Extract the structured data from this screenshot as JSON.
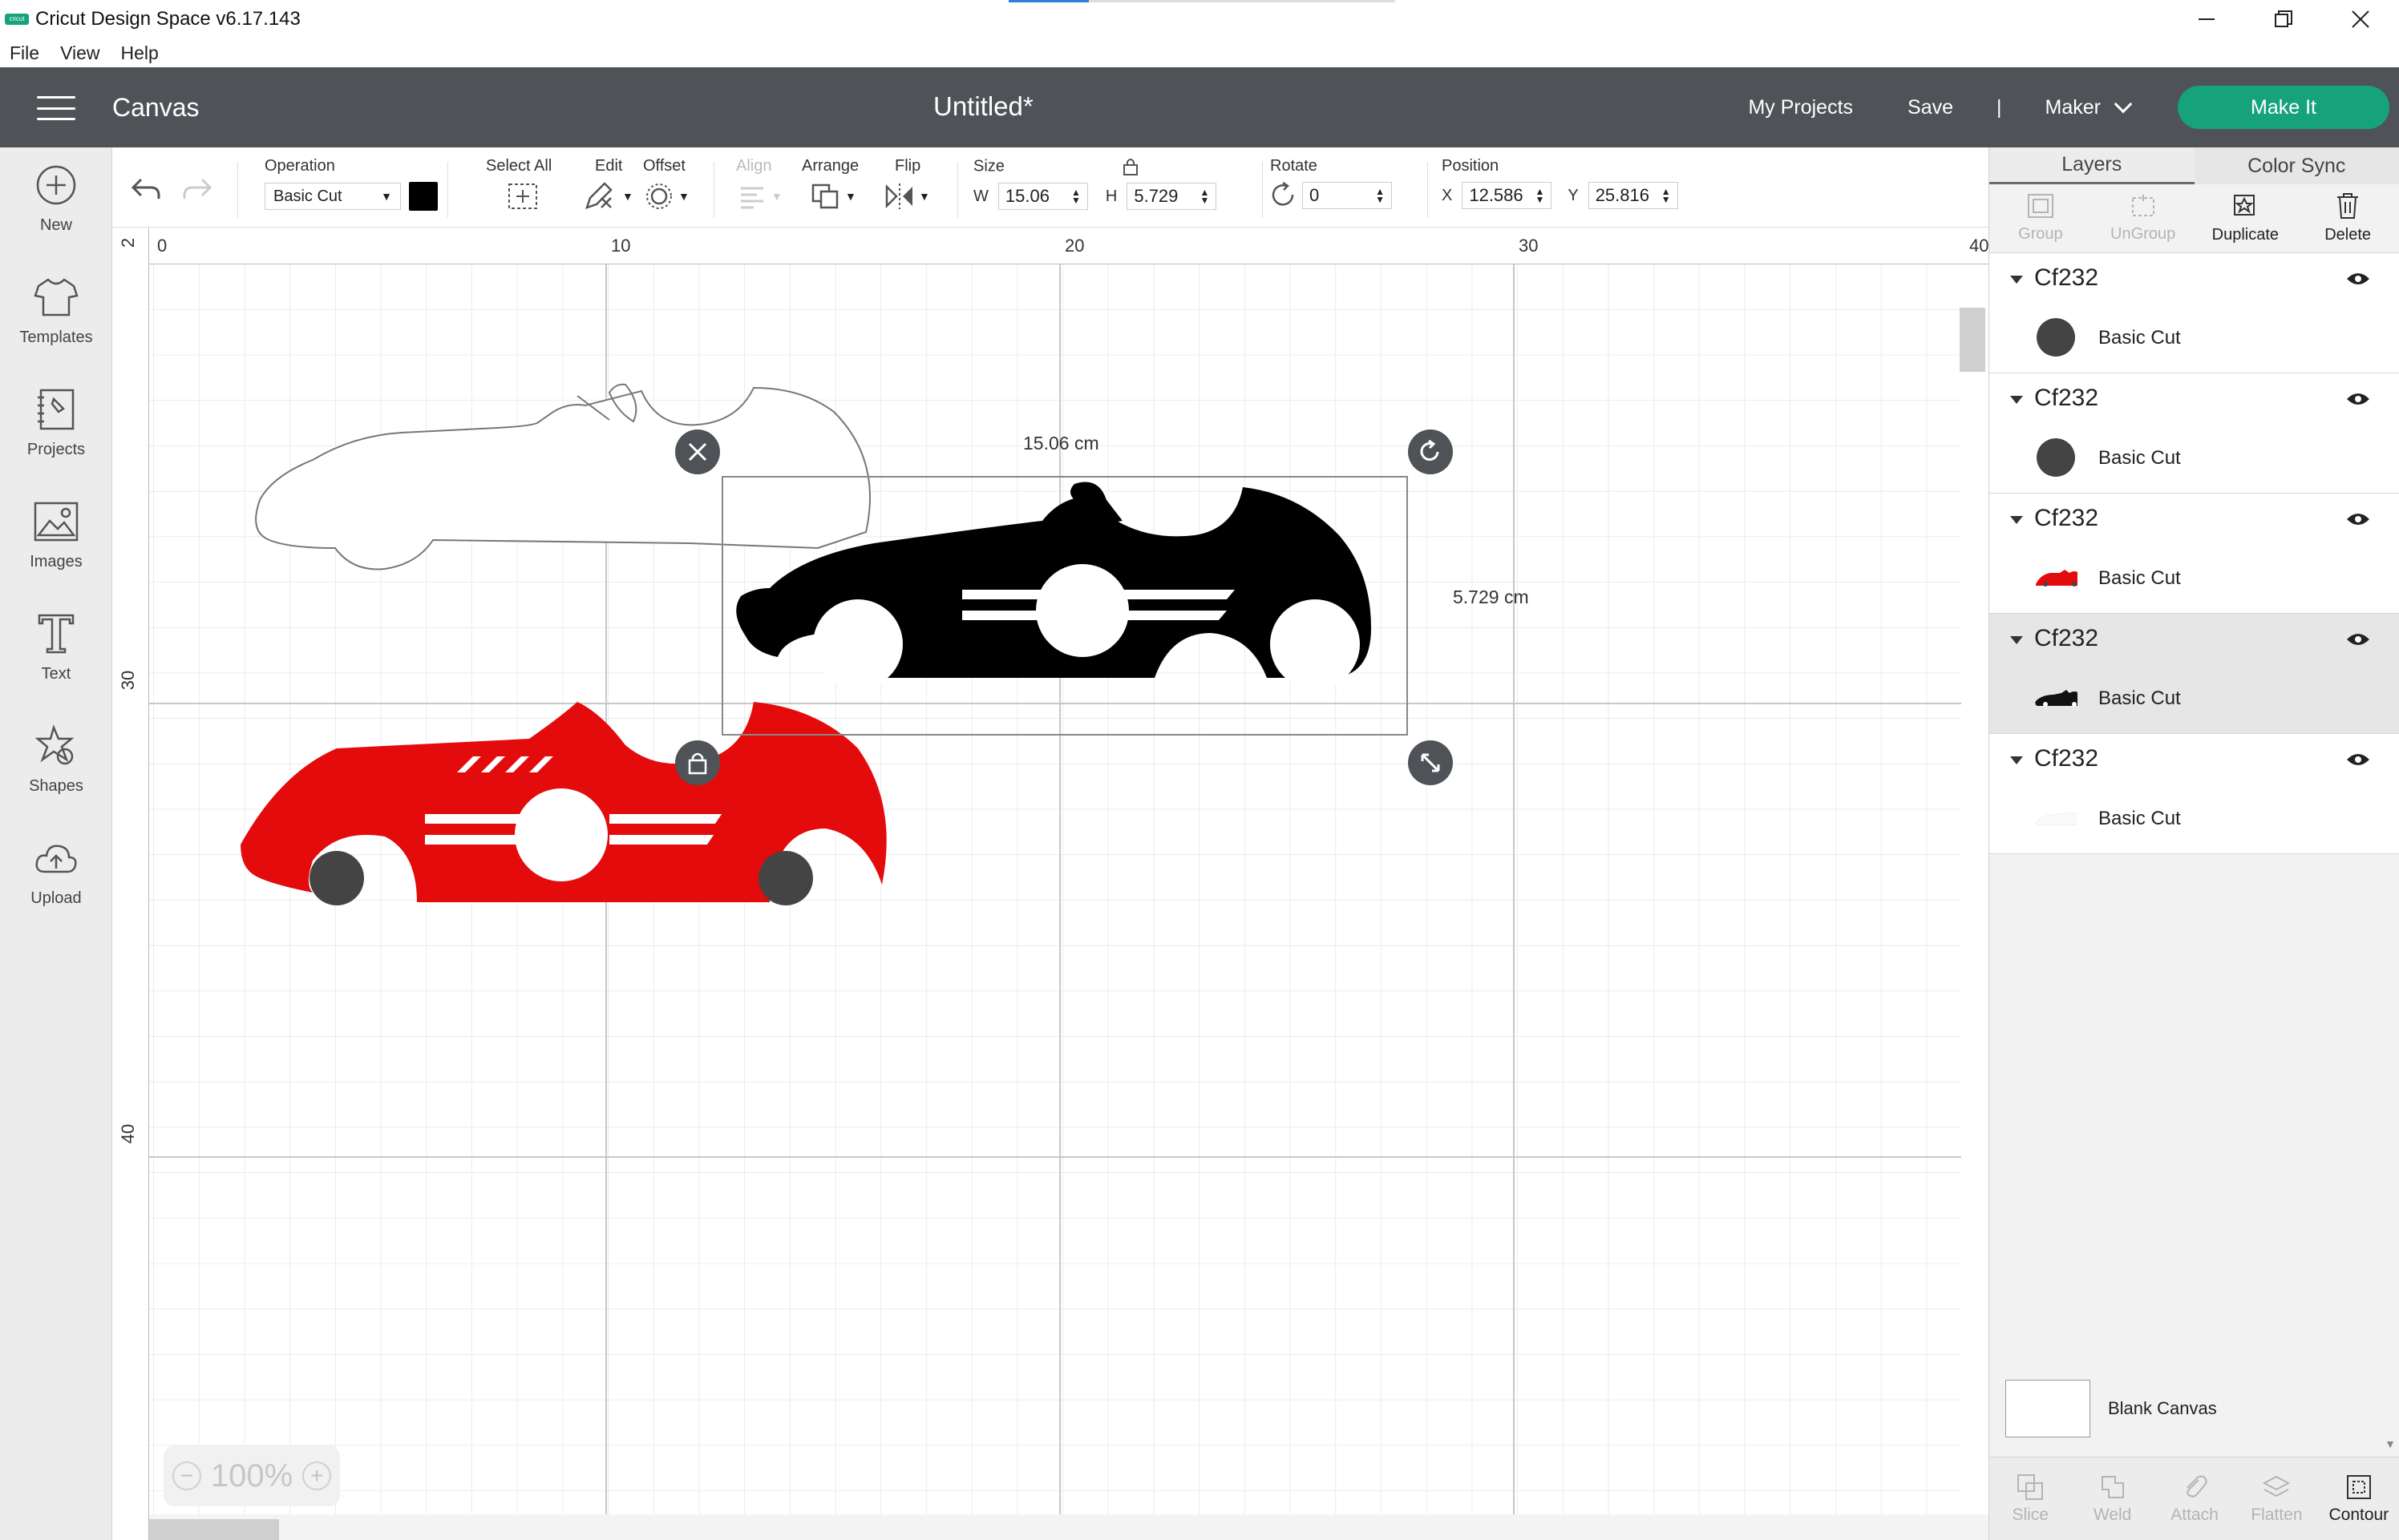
{
  "window": {
    "title": "Cricut Design Space  v6.17.143",
    "logo_text": "cricut"
  },
  "menu": [
    "File",
    "View",
    "Help"
  ],
  "header": {
    "section": "Canvas",
    "doc_title": "Untitled*",
    "my_projects": "My Projects",
    "save": "Save",
    "separator": "|",
    "machine": "Maker",
    "make_it": "Make It"
  },
  "left_toolbar": [
    {
      "label": "New",
      "icon": "plus-circle-icon"
    },
    {
      "label": "Templates",
      "icon": "tshirt-icon"
    },
    {
      "label": "Projects",
      "icon": "notebook-icon"
    },
    {
      "label": "Images",
      "icon": "image-icon"
    },
    {
      "label": "Text",
      "icon": "text-t-icon"
    },
    {
      "label": "Shapes",
      "icon": "shapes-icon"
    },
    {
      "label": "Upload",
      "icon": "cloud-upload-icon"
    }
  ],
  "edit_toolbar": {
    "operation_label": "Operation",
    "operation_value": "Basic Cut",
    "select_all": "Select All",
    "edit": "Edit",
    "offset": "Offset",
    "align": "Align",
    "arrange": "Arrange",
    "flip": "Flip",
    "size_label": "Size",
    "w_letter": "W",
    "w_value": "15.06",
    "h_letter": "H",
    "h_value": "5.729",
    "rotate_label": "Rotate",
    "rotate_value": "0",
    "position_label": "Position",
    "x_letter": "X",
    "x_value": "12.586",
    "y_letter": "Y",
    "y_value": "25.816"
  },
  "canvas": {
    "ruler_top": [
      "0",
      "10",
      "20",
      "30",
      "40"
    ],
    "ruler_left": [
      "2",
      "30",
      "40"
    ],
    "width_label": "15.06 cm",
    "height_label": "5.729 cm",
    "zoom": "100%"
  },
  "right_panel": {
    "tabs": [
      "Layers",
      "Color Sync"
    ],
    "actions": [
      {
        "label": "Group",
        "enabled": false
      },
      {
        "label": "UnGroup",
        "enabled": false
      },
      {
        "label": "Duplicate",
        "enabled": true
      },
      {
        "label": "Delete",
        "enabled": true
      }
    ],
    "layers": [
      {
        "name": "Cf232",
        "op": "Basic Cut",
        "thumb": "dot"
      },
      {
        "name": "Cf232",
        "op": "Basic Cut",
        "thumb": "dot"
      },
      {
        "name": "Cf232",
        "op": "Basic Cut",
        "thumb": "red-car"
      },
      {
        "name": "Cf232",
        "op": "Basic Cut",
        "thumb": "black-car"
      },
      {
        "name": "Cf232",
        "op": "Basic Cut",
        "thumb": "white-car"
      }
    ],
    "blank_canvas": "Blank Canvas",
    "bottom_actions": [
      {
        "label": "Slice",
        "enabled": false
      },
      {
        "label": "Weld",
        "enabled": false
      },
      {
        "label": "Attach",
        "enabled": false
      },
      {
        "label": "Flatten",
        "enabled": false
      },
      {
        "label": "Contour",
        "enabled": true
      }
    ]
  },
  "colors": {
    "header_bg": "#4f5257",
    "make_it_green": "#16a37b",
    "car_red": "#e30b0b",
    "car_black": "#000000",
    "wheel_gray": "#444444"
  }
}
